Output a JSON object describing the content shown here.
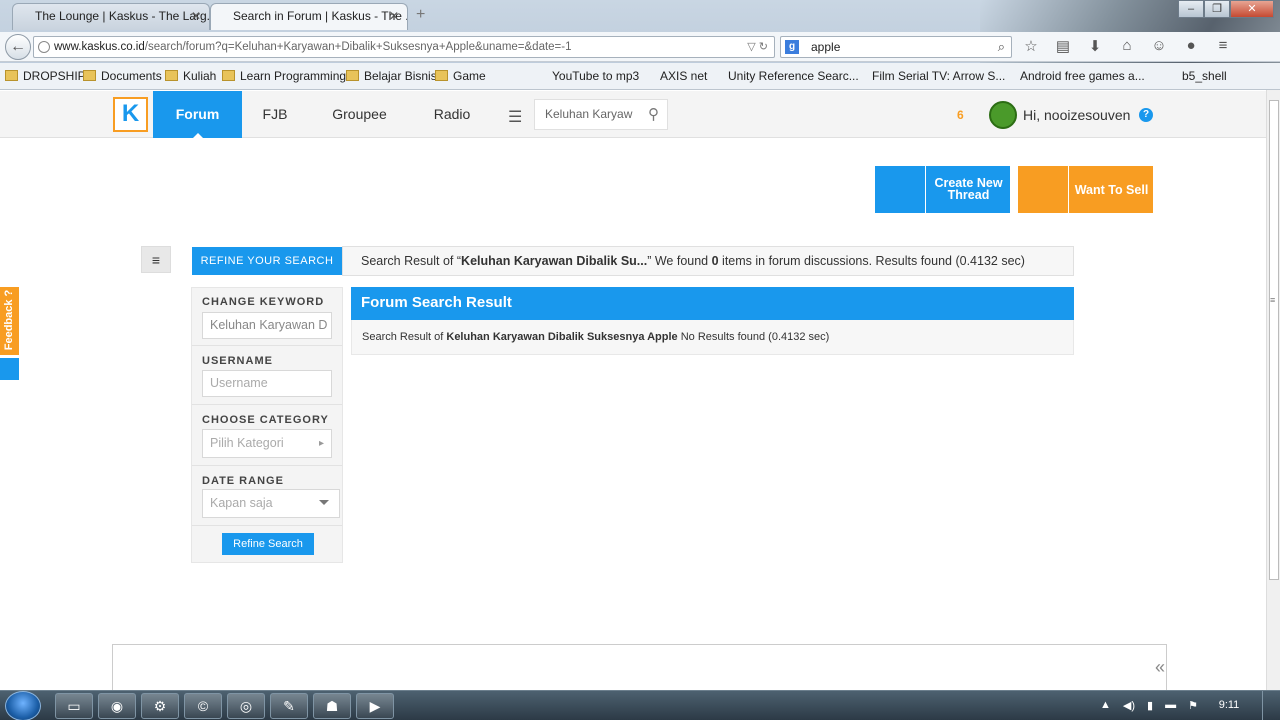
{
  "browser": {
    "tabs": [
      {
        "title": "The Lounge | Kaskus - The Larg...",
        "active": false
      },
      {
        "title": "Search in Forum | Kaskus - The ...",
        "active": true
      }
    ],
    "url_host": "www.kaskus.co.id",
    "url_path": "/search/forum?q=Keluhan+Karyawan+Dibalik+Suksesnya+Apple&uname=&date=-1",
    "search_value": "apple",
    "bookmarks": [
      "DROPSHIP",
      "Documents",
      "Kuliah",
      "Learn Programming",
      "Belajar Bisnis",
      "Game",
      "YouTube to mp3",
      "AXIS net",
      "Unity Reference Searc...",
      "Film Serial TV: Arrow S...",
      "Android free games a...",
      "b5_shell"
    ]
  },
  "header": {
    "logo": "K",
    "nav": [
      "Forum",
      "FJB",
      "Groupee",
      "Radio"
    ],
    "search_value": "Keluhan Karyaw",
    "notifications": "6",
    "greeting": "Hi, nooizesouven",
    "help": "?"
  },
  "actions": {
    "create_thread": "Create New Thread",
    "want_to_sell": "Want To Sell"
  },
  "feedback_label": "Feedback ?",
  "refine": {
    "tab_label": "REFINE YOUR SEARCH",
    "keyword_heading": "CHANGE KEYWORD",
    "keyword_value": "Keluhan Karyawan D",
    "username_heading": "USERNAME",
    "username_placeholder": "Username",
    "category_heading": "CHOOSE CATEGORY",
    "category_value": "Pilih Kategori",
    "date_heading": "DATE RANGE",
    "date_value": "Kapan saja",
    "button": "Refine Search"
  },
  "summary": {
    "prefix": "Search Result of “",
    "query": "Keluhan Karyawan Dibalik Su...",
    "middle": "” We found ",
    "count": "0",
    "suffix": " items in forum discussions. Results found (0.4132 sec)"
  },
  "result": {
    "heading": "Forum Search Result",
    "prefix": "Search Result of ",
    "query": "Keluhan Karyawan Dibalik Suksesnya Apple",
    "suffix": " No Results found (0.4132 sec)"
  },
  "taskbar": {
    "time": "9:11"
  },
  "colors": {
    "primary": "#1998ed",
    "accent": "#f89d22"
  }
}
